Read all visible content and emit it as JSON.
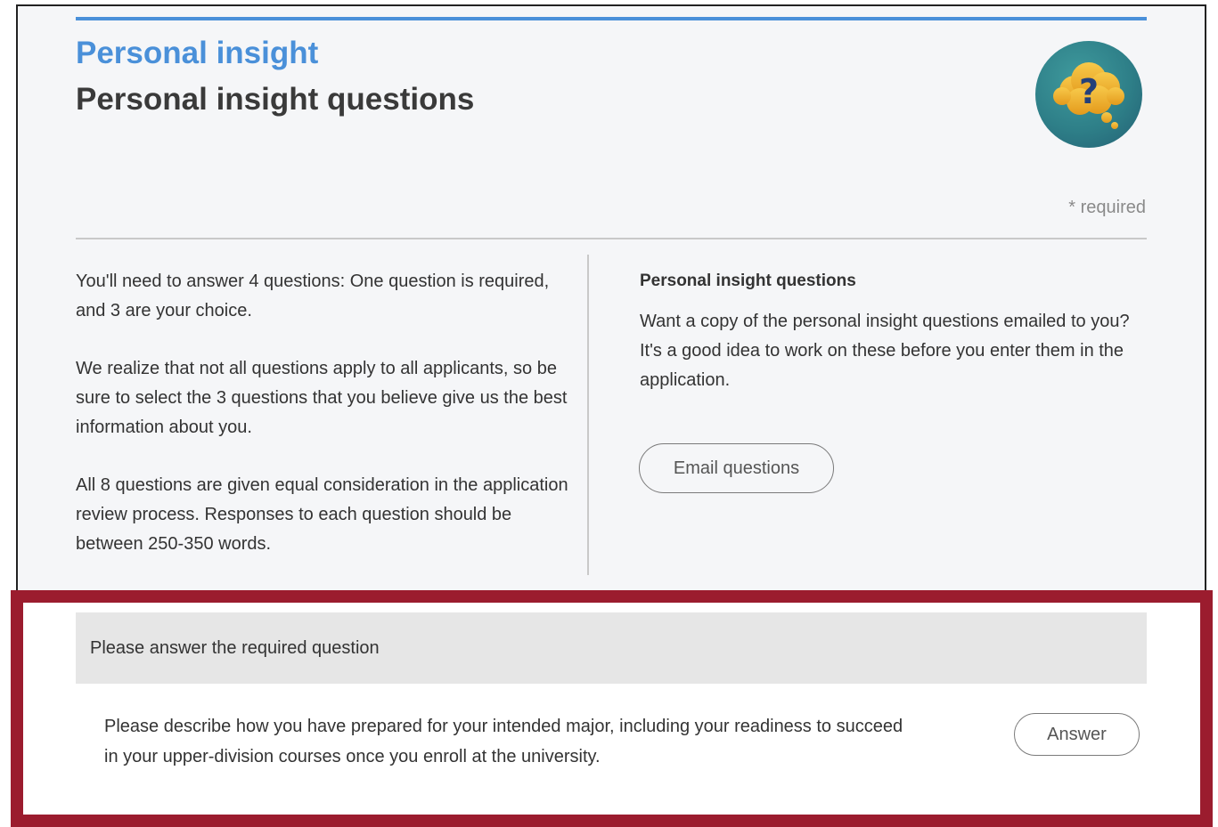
{
  "header": {
    "kicker": "Personal insight",
    "title": "Personal insight questions",
    "badge_icon": "question-thought-bubble-icon",
    "required_note": "* required"
  },
  "intro": {
    "paragraphs": [
      "You'll need to answer 4 questions: One question is required, and 3 are your choice.",
      "We realize that not all questions apply to all applicants, so be sure to select the 3 questions that you believe give us the best information about you.",
      "All 8 questions are given equal consideration in the application review process. Responses to each question should be between 250-350 words."
    ]
  },
  "email_panel": {
    "title": "Personal insight questions",
    "text": "Want a copy of the personal insight questions emailed to you? It's a good idea to work on these before you enter them in the application.",
    "button_label": "Email questions"
  },
  "required_section": {
    "heading": "Please answer the required question",
    "question": "Please describe how you have prepared for your intended major, including your readiness to succeed in your upper-division courses once you enroll at the university.",
    "answer_label": "Answer"
  },
  "colors": {
    "accent": "#4a90d9",
    "highlight_border": "#9b1c2e",
    "badge": "#2e7f88",
    "bubble": "#f0b429"
  }
}
